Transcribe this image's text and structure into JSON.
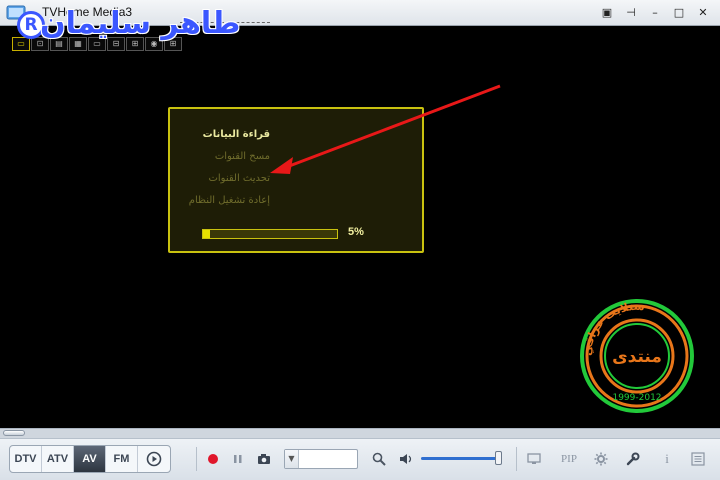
{
  "window": {
    "title": "TVHome Media3",
    "buttons": [
      "▣",
      "⊣",
      "–",
      "□",
      "✕"
    ]
  },
  "watermark": {
    "text": "طاهر سليمان",
    "registered": "R",
    "color": "#3b57ff"
  },
  "mini_toolbar": [
    "▭",
    "⊡",
    "▤",
    "▦",
    "▭",
    "⊟",
    "⊞",
    "◉",
    "⊞"
  ],
  "dialog": {
    "items": [
      "قراءة البيانات",
      "مسح القنوات",
      "تحديث القنوات",
      "إعادة تشغيل النظام"
    ],
    "selected_index": 0,
    "progress": 5,
    "progress_label": "5%",
    "border_color": "#c9c20f"
  },
  "stamp": {
    "center_text": "منتدى",
    "ring_text": "ستلايت عراقي",
    "ring_text_2": "1999-2012"
  },
  "controls": {
    "modes": [
      "DTV",
      "ATV",
      "AV",
      "FM"
    ],
    "active_mode": "AV",
    "pip_label": "PIP",
    "info_label": "i",
    "volume": 0.95,
    "accent": "#2f6fd0"
  }
}
